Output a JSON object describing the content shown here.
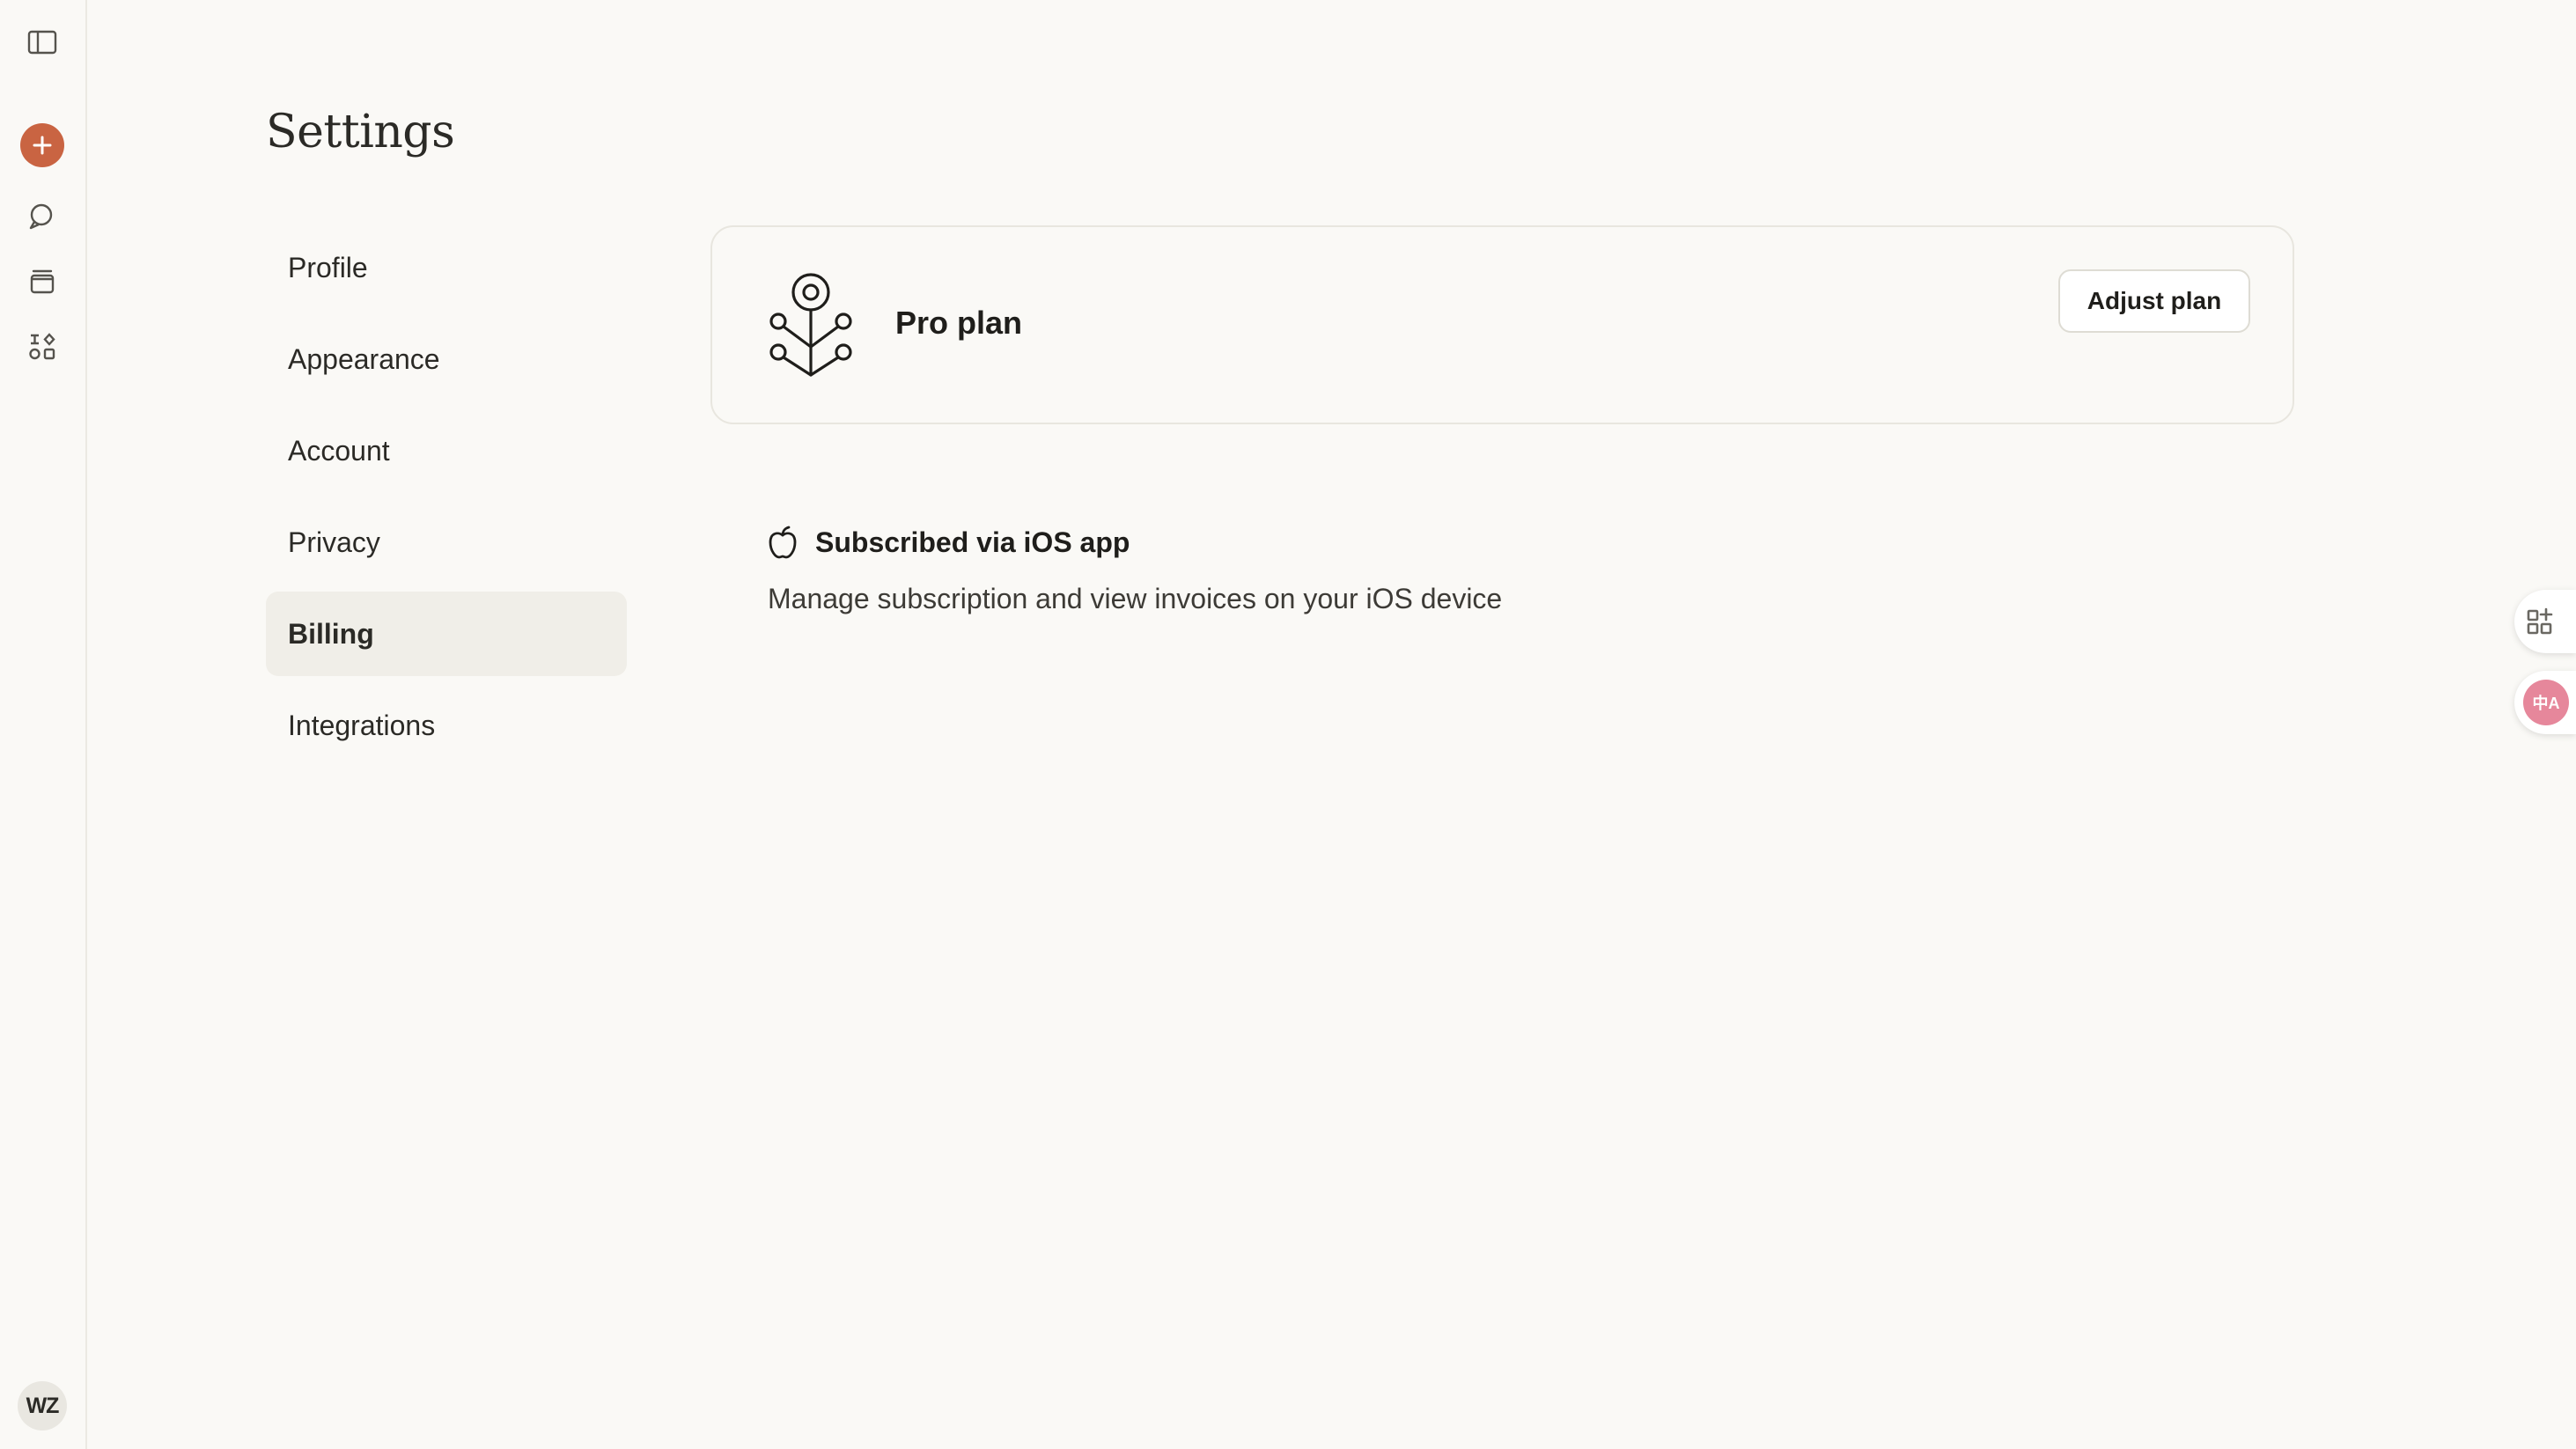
{
  "sidebar": {
    "avatar_initials": "WZ",
    "accent_color": "#c96442"
  },
  "page": {
    "title": "Settings"
  },
  "settings_nav": {
    "items": [
      {
        "label": "Profile"
      },
      {
        "label": "Appearance"
      },
      {
        "label": "Account"
      },
      {
        "label": "Privacy"
      },
      {
        "label": "Billing",
        "active": true
      },
      {
        "label": "Integrations"
      }
    ]
  },
  "plan": {
    "name": "Pro plan",
    "adjust_label": "Adjust plan"
  },
  "subscription": {
    "title": "Subscribed via iOS app",
    "description": "Manage subscription and view invoices on your iOS device"
  },
  "floating_widgets": {
    "translate_glyph": "中A"
  }
}
